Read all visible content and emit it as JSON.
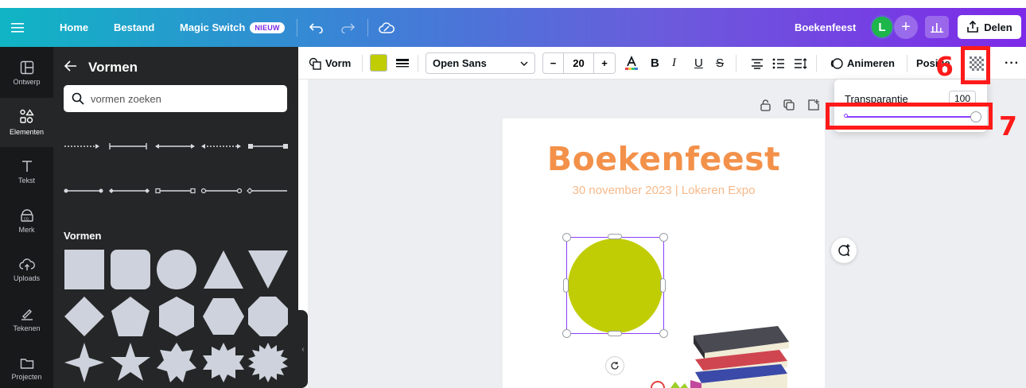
{
  "topbar": {
    "nav": [
      {
        "label": "Home"
      },
      {
        "label": "Bestand"
      },
      {
        "label": "Magic Switch",
        "badge": "NIEUW"
      }
    ],
    "design_name": "Boekenfeest",
    "avatar_initial": "L",
    "share_label": "Delen"
  },
  "rail": {
    "items": [
      {
        "label": "Ontwerp",
        "icon": "layout-icon"
      },
      {
        "label": "Elementen",
        "icon": "elements-icon",
        "active": true
      },
      {
        "label": "Tekst",
        "icon": "text-icon"
      },
      {
        "label": "Merk",
        "icon": "brand-icon"
      },
      {
        "label": "Uploads",
        "icon": "upload-cloud-icon"
      },
      {
        "label": "Tekenen",
        "icon": "draw-icon"
      },
      {
        "label": "Projecten",
        "icon": "folder-icon"
      }
    ]
  },
  "panel": {
    "title": "Vormen",
    "search_placeholder": "vormen zoeken",
    "section_label": "Vormen"
  },
  "toolbar": {
    "shape_label": "Vorm",
    "shape_color": "#c0cd04",
    "font_name": "Open Sans",
    "font_size": "20",
    "minus": "−",
    "plus": "+",
    "bold": "B",
    "italic": "I",
    "underline": "U",
    "strike": "S",
    "animate_label": "Animeren",
    "position_label": "Positie",
    "more": "···"
  },
  "canvas": {
    "title": "Boekenfeest",
    "subtitle": "30 november 2023 | Lokeren Expo",
    "title_color": "#f3914a",
    "shape_fill": "#c0cd04"
  },
  "transparency": {
    "label": "Transparantie",
    "value": "100",
    "slider_value": 100
  },
  "annotations": {
    "step6": "6",
    "step7": "7",
    "color": "#ff1a1a"
  }
}
